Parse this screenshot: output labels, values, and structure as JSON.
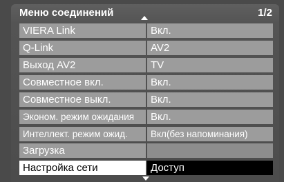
{
  "menu": {
    "title": "Меню соединений",
    "page": "1/2",
    "items": [
      {
        "label": "VIERA Link",
        "value": "Вкл."
      },
      {
        "label": "Q-Link",
        "value": "AV2"
      },
      {
        "label": "Выход AV2",
        "value": "TV"
      },
      {
        "label": "Совместное вкл.",
        "value": "Вкл."
      },
      {
        "label": "Совместное выкл.",
        "value": "Вкл."
      },
      {
        "label": "Эконом. режим ожидания",
        "value": "Вкл."
      },
      {
        "label": "Интеллект. режим ожид.",
        "value": "Вкл(без напоминания)"
      },
      {
        "label": "Загрузка",
        "value": ""
      },
      {
        "label": "Настройка сети",
        "value": "Доступ"
      }
    ]
  }
}
